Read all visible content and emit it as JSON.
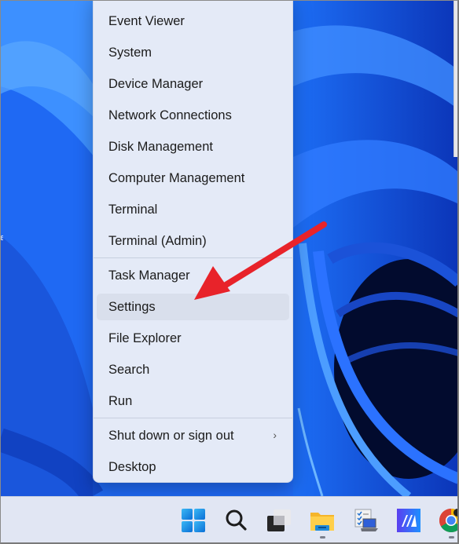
{
  "menu": {
    "items": [
      {
        "label": "Event Viewer"
      },
      {
        "label": "System"
      },
      {
        "label": "Device Manager"
      },
      {
        "label": "Network Connections"
      },
      {
        "label": "Disk Management"
      },
      {
        "label": "Computer Management"
      },
      {
        "label": "Terminal"
      },
      {
        "label": "Terminal (Admin)"
      },
      {
        "label": "Task Manager"
      },
      {
        "label": "Settings"
      },
      {
        "label": "File Explorer"
      },
      {
        "label": "Search"
      },
      {
        "label": "Run"
      },
      {
        "label": "Shut down or sign out",
        "submenu": true,
        "chevron": "›"
      },
      {
        "label": "Desktop"
      }
    ],
    "highlighted": "Settings"
  },
  "annotation": {
    "type": "arrow",
    "color": "#e8232a",
    "target": "Settings"
  },
  "taskbar": {
    "icons": [
      {
        "name": "start",
        "icon": "windows-logo-icon",
        "running": false
      },
      {
        "name": "search",
        "icon": "search-icon",
        "running": false
      },
      {
        "name": "task-view",
        "icon": "task-view-icon",
        "running": false
      },
      {
        "name": "file-explorer",
        "icon": "folder-icon",
        "running": true
      },
      {
        "name": "task-scheduler",
        "icon": "checklist-laptop-icon",
        "running": false
      },
      {
        "name": "app-ma",
        "icon": "ma-app-icon",
        "running": false
      },
      {
        "name": "chrome",
        "icon": "chrome-icon",
        "running": true
      }
    ]
  },
  "colors": {
    "accent": "#0f78d4",
    "arrow": "#e8232a",
    "menu_bg": "#e4eaf7"
  }
}
